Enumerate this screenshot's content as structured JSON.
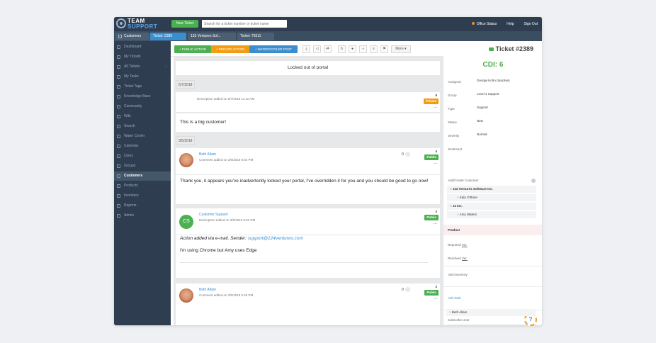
{
  "header": {
    "logo_top": "TEAM",
    "logo_bottom": "SUPPORT",
    "new_ticket": "New Ticket",
    "search_placeholder": "Search for a ticket number or ticket name",
    "office_status": "Office Status",
    "help": "Help",
    "sign_out": "Sign Out"
  },
  "tabs": [
    "Customers",
    "Ticket: 2389",
    "133 Ventures Sof...",
    "Ticket: 76511"
  ],
  "sidebar": {
    "items": [
      {
        "label": "Dashboard"
      },
      {
        "label": "My Tickets"
      },
      {
        "label": "All Tickets",
        "chevron": "›"
      },
      {
        "label": "My Tasks"
      },
      {
        "label": "Ticket Tags"
      },
      {
        "label": "Knowledge Base"
      },
      {
        "label": "Community"
      },
      {
        "label": "Wiki"
      },
      {
        "label": "Search"
      },
      {
        "label": "Water Cooler"
      },
      {
        "label": "Calendar"
      },
      {
        "label": "Users"
      },
      {
        "label": "Groups"
      },
      {
        "label": "Customers",
        "active": true
      },
      {
        "label": "Products"
      },
      {
        "label": "Inventory"
      },
      {
        "label": "Reports"
      },
      {
        "label": "Admin"
      }
    ]
  },
  "toolbar": {
    "public_action": "+ PUBLIC ACTION",
    "private_action": "+ PRIVATE ACTION",
    "watercooler_post": "+ WATERCOOLER POST",
    "icons": [
      "download-icon",
      "megaphone-icon",
      "swap-icon",
      "refresh-icon",
      "record-icon",
      "rss-icon",
      "list-icon",
      "flag-icon"
    ],
    "icon_glyphs": [
      "⤓",
      "◁",
      "⇄",
      "↻",
      "●",
      "◗",
      "≡",
      "⚑"
    ],
    "more": "More ▾",
    "ticket_title": "Ticket #2389"
  },
  "feed": {
    "subject": "Locked out of portal",
    "date1": "5/7/2018",
    "desc1_meta": "Description added on 5/7/2018 11:10 AM",
    "desc1_num": "5",
    "desc1_badge": "Private",
    "desc1_body": "This is a big customer!",
    "date2": "3/5/2018",
    "c1_author": "Beth Allam",
    "c1_meta": "Comment added on 3/5/2018 6:54 PM",
    "c1_likes": "0",
    "c1_num": "4",
    "c1_badge": "Public",
    "c1_body": "Thank you, it appears you've inadvertently locked your portal, I've overridden it for you and you should be good to go now!",
    "c2_author": "Customer Support",
    "c2_initials": "CS",
    "c2_meta": "Description added on 3/5/2018 5:53 PM",
    "c2_num": "3",
    "c2_badge": "Public",
    "c2_body_prefix": "Action added via e-mail. Sender:",
    "c2_body_email": "support@124ventures.com",
    "c2_body2": "I'm using Chrome but Amy uses Edge",
    "c3_author": "Beth Allam",
    "c3_meta": "Comment added on 3/5/2018 5:45 PM",
    "c3_likes": "0",
    "c3_num": "2",
    "c3_badge": "Public",
    "more_dots": "..."
  },
  "details": {
    "cdi": "CDI: 6",
    "props": [
      {
        "label": "Assigned",
        "value": "George Kohn (Inactive)"
      },
      {
        "label": "Group",
        "value": "Level 1 Support"
      },
      {
        "label": "Type",
        "value": "Support"
      },
      {
        "label": "Status",
        "value": "New"
      },
      {
        "label": "Severity",
        "value": "Normal"
      },
      {
        "label": "Sentiment",
        "value": ""
      }
    ],
    "add_customer": "Add/Create Customer",
    "customers": [
      {
        "label": "133 Ventures Software Inc.",
        "bold": true
      },
      {
        "label": "Kala O'Brien",
        "bold": false
      },
      {
        "label": "J4 Inc.",
        "bold": true
      },
      {
        "label": "Amy Waters",
        "bold": false
      }
    ],
    "product": "Product",
    "reported_label": "Reported",
    "resolved_label": "Resolved",
    "ver": "Ver.",
    "add_inventory": "Add Inventory",
    "add_task": "Add Task",
    "subscribe_user": "Subscribe User",
    "subscriber": "Beth Allam"
  },
  "colors": {
    "nav_bg": "#2e3e50",
    "accent_blue": "#3a8ed0",
    "green": "#4caf50",
    "orange": "#f39c12"
  }
}
